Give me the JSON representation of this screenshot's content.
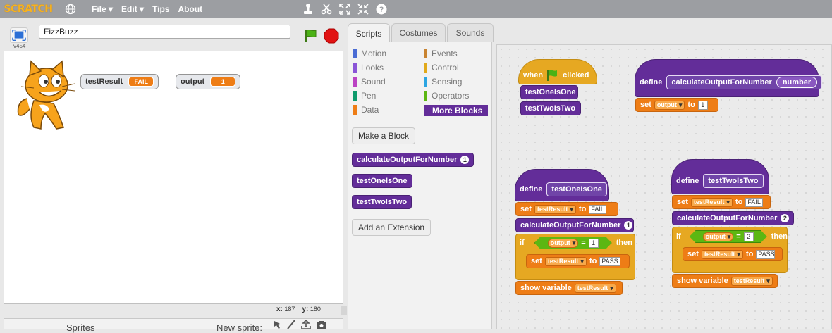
{
  "topbar": {
    "logo": "SCRATCH",
    "menus": [
      "File ▾",
      "Edit ▾",
      "Tips",
      "About"
    ]
  },
  "stage": {
    "version": "v454",
    "project_name": "FizzBuzz",
    "monitors": [
      {
        "label": "testResult",
        "value": "FAIL"
      },
      {
        "label": "output",
        "value": "1"
      }
    ],
    "x_label": "x:",
    "x_value": "187",
    "y_label": "y:",
    "y_value": "180"
  },
  "sprites": {
    "label": "Sprites",
    "new_sprite": "New sprite:"
  },
  "tabs": [
    "Scripts",
    "Costumes",
    "Sounds"
  ],
  "categories": {
    "left": [
      {
        "label": "Motion",
        "color": "#4a6cd4"
      },
      {
        "label": "Looks",
        "color": "#8a55d7"
      },
      {
        "label": "Sound",
        "color": "#bb42c3"
      },
      {
        "label": "Pen",
        "color": "#0e9a6c"
      },
      {
        "label": "Data",
        "color": "#ee7d16"
      }
    ],
    "right": [
      {
        "label": "Events",
        "color": "#c88330"
      },
      {
        "label": "Control",
        "color": "#e1a91a"
      },
      {
        "label": "Sensing",
        "color": "#2ca5e2"
      },
      {
        "label": "Operators",
        "color": "#5cb712"
      },
      {
        "label": "More Blocks",
        "color": "#632d99"
      }
    ]
  },
  "palette": {
    "make_block": "Make a Block",
    "add_extension": "Add an Extension",
    "blocks": [
      "calculateOutputForNumber",
      "testOneIsOne",
      "testTwoIsTwo"
    ],
    "calc_arg": "1"
  },
  "scripts": {
    "when": "when",
    "clicked": "clicked",
    "testOneIsOne": "testOneIsOne",
    "testTwoIsTwo": "testTwoIsTwo",
    "define": "define",
    "calc": "calculateOutputForNumber",
    "number": "number",
    "set": "set",
    "to": "to",
    "output": "output",
    "testResult": "testResult",
    "one": "1",
    "two": "2",
    "FAIL": "FAIL",
    "PASS": "PASS",
    "if": "if",
    "then": "then",
    "eq": "=",
    "show_variable": "show variable"
  }
}
